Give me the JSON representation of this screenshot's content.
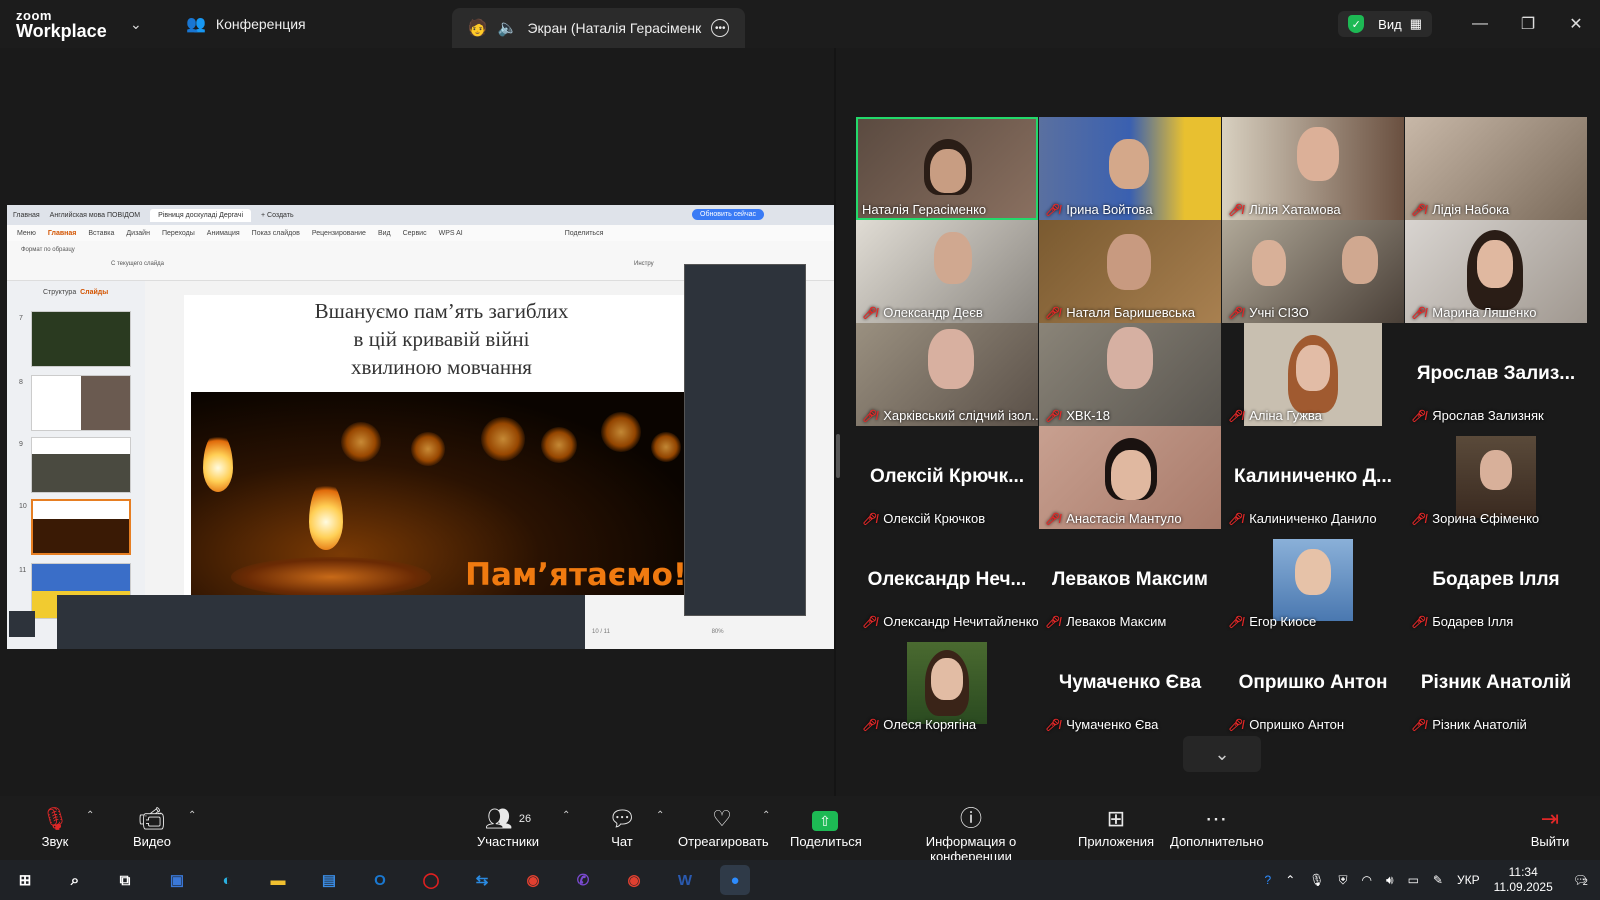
{
  "titlebar": {
    "logo_line1": "zoom",
    "logo_line2": "Workplace",
    "tab_conference": "Конференция",
    "tab_screen": "Экран (Наталія Герасіменк",
    "view_label": "Вид"
  },
  "shared_screen": {
    "browser_tabs": [
      "Главная",
      "Английская мова ПОВІДОМ",
      "Рівниця доскуладі Дергачі",
      "+ Создать"
    ],
    "update_button": "Обновить сейчас",
    "menu": [
      "Меню",
      "Главная",
      "Вставка",
      "Дизайн",
      "Переходы",
      "Анимация",
      "Показ слайдов",
      "Рецензирование",
      "Вид",
      "Сервис",
      "WPS AI"
    ],
    "share_label": "Поделиться",
    "ribbon_format": "Формат по образцу",
    "ribbon_from_current": "С текущего слайда",
    "ribbon_tools": "Инстру",
    "panel_structure": "Структура",
    "panel_slides": "Слайды",
    "slide_numbers": [
      "7",
      "8",
      "9",
      "10",
      "11"
    ],
    "slide_counter": "10 / 11",
    "zoom_level": "80%",
    "slide_title_1": "Вшануємо пам’ять загиблих",
    "slide_title_2": "в цій кривавій війні",
    "slide_title_3": "хвилиною мовчання",
    "slide_slogan": "Пам’ятаємо!"
  },
  "gallery": {
    "participants": [
      {
        "name": "Наталія Герасіменко",
        "muted": false,
        "video": true,
        "active": true
      },
      {
        "name": "Ірина Войтова",
        "muted": true,
        "video": true
      },
      {
        "name": "Лілія Хатамова",
        "muted": true,
        "video": true
      },
      {
        "name": "Лідія Набока",
        "muted": true,
        "video": true
      },
      {
        "name": "Олександр Деєв",
        "muted": true,
        "video": true
      },
      {
        "name": "Наталя Баришевська",
        "muted": true,
        "video": true
      },
      {
        "name": "Учні СІЗО",
        "muted": true,
        "video": true
      },
      {
        "name": "Марина Ляшенко",
        "muted": true,
        "video": true
      },
      {
        "name": "Харківський слідчий ізол...",
        "muted": true,
        "video": true
      },
      {
        "name": "ХВК-18",
        "muted": true,
        "video": true
      },
      {
        "name": "Аліна Гужва",
        "muted": true,
        "video": true
      },
      {
        "name": "Ярослав契Зализняк",
        "big": "Ярослав Зализ...",
        "muted": true,
        "video": false
      },
      {
        "name": "Олексій Крючков",
        "big": "Олексій Крючк...",
        "muted": true,
        "video": false
      },
      {
        "name": "Анастасія Мантуло",
        "muted": true,
        "video": true
      },
      {
        "name": "Калиниченко Данило",
        "big": "Калиниченко Д...",
        "muted": true,
        "video": false
      },
      {
        "name": "Зорина Єфіменко",
        "muted": true,
        "avatar": true
      },
      {
        "name": "Олександр Нечитайленко",
        "big": "Олександр Неч...",
        "muted": true,
        "video": false
      },
      {
        "name": "Леваков Максим",
        "big": "Леваков Максим",
        "muted": true,
        "video": false
      },
      {
        "name": "Егор Киосе",
        "muted": true,
        "avatar": true
      },
      {
        "name": "Бодарев Ілля",
        "big": "Бодарев Ілля",
        "muted": true,
        "video": false
      },
      {
        "name": "Олеся Корягіна",
        "muted": true,
        "avatar": true
      },
      {
        "name": "Чумаченко Єва",
        "big": "Чумаченко Єва",
        "muted": true,
        "video": false
      },
      {
        "name": "Опришко Антон",
        "big": "Опришко Антон",
        "muted": true,
        "video": false
      },
      {
        "name": "Різник Анатолій",
        "big": "Різник Анатолій",
        "muted": true,
        "video": false
      }
    ]
  },
  "toolbar": {
    "audio": "Звук",
    "video": "Видео",
    "participants": "Участники",
    "participants_count": "26",
    "chat": "Чат",
    "react": "Отреагировать",
    "share": "Поделиться",
    "info": "Информация о конференции",
    "apps": "Приложения",
    "more": "Дополнительно",
    "leave": "Выйти"
  },
  "taskbar": {
    "language": "УКР",
    "time": "11:34",
    "date": "11.09.2025",
    "notifications": "2"
  },
  "colors": {
    "active_speaker": "#23d96b",
    "muted_icon": "#e02828",
    "share_green": "#1db954",
    "slide_orange": "#f07a10"
  }
}
